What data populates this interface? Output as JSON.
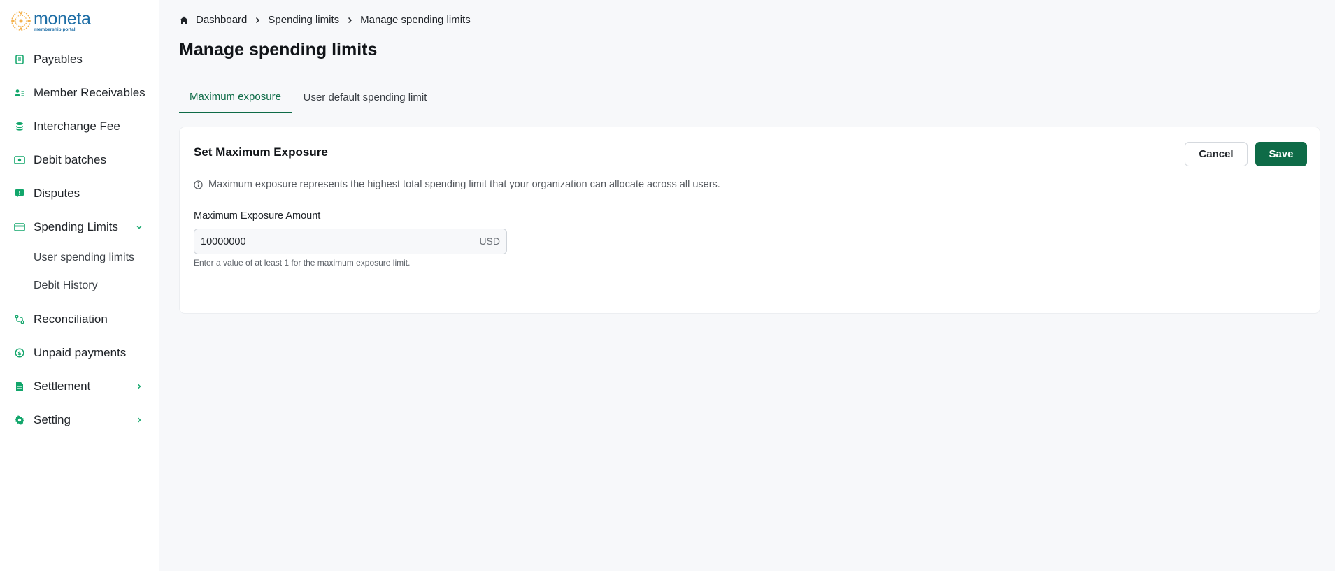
{
  "brand": {
    "name": "moneta",
    "tagline": "membership portal",
    "accent": "#0e6b47",
    "logo_color": "#1e6ea6"
  },
  "sidebar": {
    "items": [
      {
        "label": "Payables",
        "icon": "receipt-icon"
      },
      {
        "label": "Member Receivables",
        "icon": "users-list-icon"
      },
      {
        "label": "Interchange Fee",
        "icon": "coins-stack-icon"
      },
      {
        "label": "Debit batches",
        "icon": "banknote-icon"
      },
      {
        "label": "Disputes",
        "icon": "alert-message-icon"
      },
      {
        "label": "Spending Limits",
        "icon": "credit-card-icon",
        "expanded": true,
        "children": [
          {
            "label": "User spending limits"
          },
          {
            "label": "Debit History"
          }
        ]
      },
      {
        "label": "Reconciliation",
        "icon": "reconcile-icon"
      },
      {
        "label": "Unpaid payments",
        "icon": "dollar-circle-icon"
      },
      {
        "label": "Settlement",
        "icon": "document-icon",
        "has_children": true
      },
      {
        "label": "Setting",
        "icon": "gear-icon",
        "has_children": true
      }
    ]
  },
  "breadcrumb": [
    "Dashboard",
    "Spending limits",
    "Manage spending limits"
  ],
  "page": {
    "title": "Manage spending limits"
  },
  "tabs": [
    {
      "label": "Maximum exposure",
      "active": true
    },
    {
      "label": "User default spending limit",
      "active": false
    }
  ],
  "card": {
    "title": "Set Maximum Exposure",
    "cancel_label": "Cancel",
    "save_label": "Save",
    "info_text": "Maximum exposure represents the highest total spending limit that your organization can allocate across all users.",
    "field_label": "Maximum Exposure Amount",
    "field_value": "10000000",
    "field_suffix": "USD",
    "helper_text": "Enter a value of at least 1 for the maximum exposure limit."
  }
}
